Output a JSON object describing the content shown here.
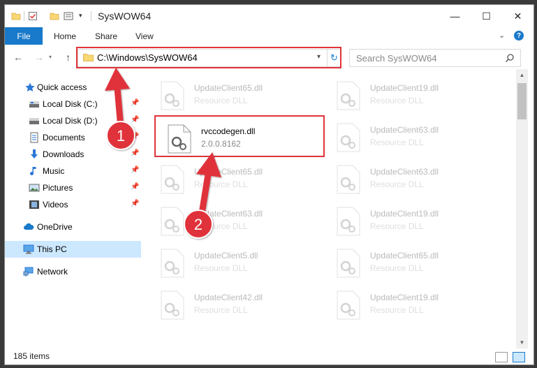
{
  "window": {
    "title": "SysWOW64"
  },
  "titlebar_buttons": {
    "minimize": "—",
    "maximize": "☐",
    "close": "✕"
  },
  "ribbon": {
    "file": "File",
    "home": "Home",
    "share": "Share",
    "view": "View",
    "help": "?"
  },
  "nav": {
    "address": "C:\\Windows\\SysWOW64",
    "search_placeholder": "Search SysWOW64"
  },
  "sidebar": {
    "items": [
      {
        "label": "Quick access",
        "icon": "star-icon"
      },
      {
        "label": "Local Disk (C:)",
        "icon": "drive-icon",
        "pinned": true
      },
      {
        "label": "Local Disk (D:)",
        "icon": "drive-icon",
        "pinned": true
      },
      {
        "label": "Documents",
        "icon": "documents-icon",
        "pinned": true
      },
      {
        "label": "Downloads",
        "icon": "download-icon",
        "pinned": true
      },
      {
        "label": "Music",
        "icon": "music-icon",
        "pinned": true
      },
      {
        "label": "Pictures",
        "icon": "pictures-icon",
        "pinned": true
      },
      {
        "label": "Videos",
        "icon": "videos-icon",
        "pinned": true
      },
      {
        "label": "OneDrive",
        "icon": "cloud-icon"
      },
      {
        "label": "This PC",
        "icon": "computer-icon",
        "selected": true
      },
      {
        "label": "Network",
        "icon": "network-icon"
      }
    ]
  },
  "files": {
    "highlighted": {
      "name": "rvccodegen.dll",
      "version": "2.0.0.8162"
    },
    "left_column": [
      {
        "name": "UpdateClient65.dll",
        "type": "Resource DLL"
      },
      {
        "name": "UpdateClient65.dll",
        "type": "Resource DLL"
      },
      {
        "name": "UpdateClient63.dll",
        "type": "Resource DLL"
      },
      {
        "name": "UpdateClient5.dll",
        "type": "Resource DLL"
      },
      {
        "name": "UpdateClient42.dll",
        "type": "Resource DLL"
      }
    ],
    "right_column": [
      {
        "name": "UpdateClient19.dll",
        "type": "Resource DLL"
      },
      {
        "name": "UpdateClient63.dll",
        "type": "Resource DLL"
      },
      {
        "name": "UpdateClient63.dll",
        "type": "Resource DLL"
      },
      {
        "name": "UpdateClient19.dll",
        "type": "Resource DLL"
      },
      {
        "name": "UpdateClient65.dll",
        "type": "Resource DLL"
      },
      {
        "name": "UpdateClient19.dll",
        "type": "Resource DLL"
      }
    ]
  },
  "status": {
    "count": "185 items"
  },
  "annotations": {
    "step1": "1",
    "step2": "2",
    "color": "#e0333a"
  }
}
